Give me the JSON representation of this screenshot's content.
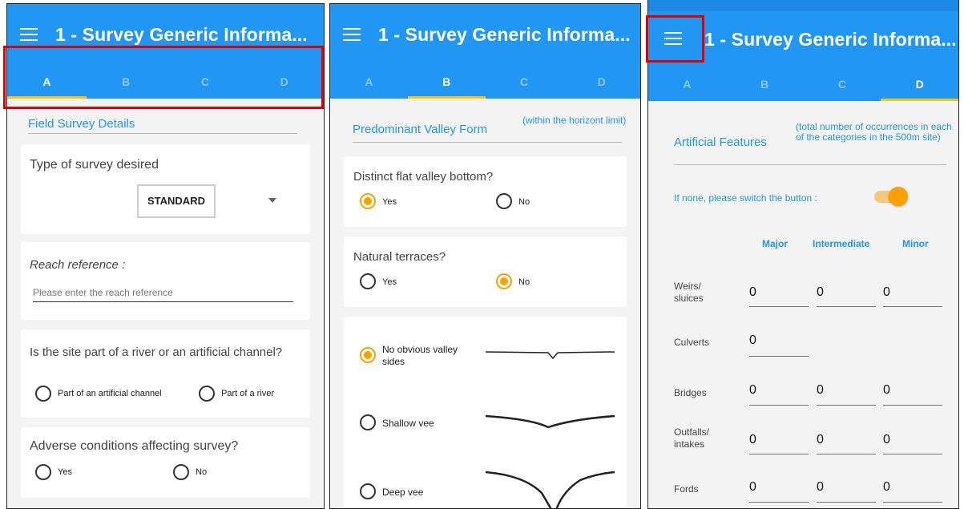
{
  "app_title": "1 - Survey Generic Informa...",
  "tabs": [
    "A",
    "B",
    "C",
    "D"
  ],
  "panel_a": {
    "section_title": "Field Survey Details",
    "survey_type": {
      "label": "Type of survey desired",
      "value": "STANDARD"
    },
    "reach": {
      "label": "Reach reference :",
      "placeholder": "Please enter the reach reference"
    },
    "river_question": {
      "label": "Is the site part of a river or an artificial channel?",
      "option1": "Part of an artificial channel",
      "option2": "Part of a river"
    },
    "adverse": {
      "label": "Adverse conditions affecting survey?",
      "yes": "Yes",
      "no": "No"
    }
  },
  "panel_b": {
    "section_title": "Predominant Valley Form",
    "section_note": "(within the horizont limit)",
    "flat_bottom": {
      "label": "Distinct flat valley bottom?",
      "yes": "Yes",
      "no": "No",
      "selected": "Yes"
    },
    "terraces": {
      "label": "Natural terraces?",
      "yes": "Yes",
      "no": "No",
      "selected": "No"
    },
    "valley_options": [
      "No obvious valley sides",
      "Shallow vee",
      "Deep vee"
    ],
    "valley_selected": "No obvious valley sides"
  },
  "panel_c": {
    "section_title": "Artificial Features",
    "section_note": "(total number of occurrences in each of the categories in the 500m site)",
    "switch_label": "If none, please switch the button :",
    "switch_on": true,
    "columns": [
      "Major",
      "Intermediate",
      "Minor"
    ],
    "rows": [
      {
        "label": "Weirs/ sluices",
        "values": [
          "0",
          "0",
          "0"
        ]
      },
      {
        "label": "Culverts",
        "values": [
          "0"
        ]
      },
      {
        "label": "Bridges",
        "values": [
          "0",
          "0",
          "0"
        ]
      },
      {
        "label": "Outfalls/ intakes",
        "values": [
          "0",
          "0",
          "0"
        ]
      },
      {
        "label": "Fords",
        "values": [
          "0",
          "0",
          "0"
        ]
      }
    ]
  },
  "colors": {
    "primary": "#2196f3",
    "accent": "#ffc107",
    "radio_selected": "#ffa000",
    "highlight_box": "#e00000"
  }
}
